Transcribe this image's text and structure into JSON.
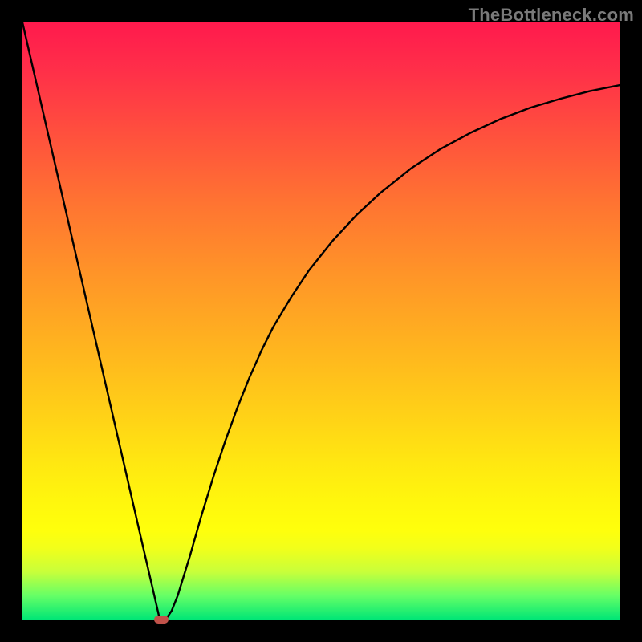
{
  "watermark": "TheBottleneck.com",
  "colors": {
    "frame": "#000000",
    "curve": "#000000",
    "marker": "#c1524a"
  },
  "chart_data": {
    "type": "line",
    "title": "",
    "xlabel": "",
    "ylabel": "",
    "xlim": [
      0,
      100
    ],
    "ylim": [
      0,
      100
    ],
    "x": [
      0,
      2,
      4,
      6,
      8,
      10,
      12,
      14,
      16,
      18,
      20,
      22,
      23,
      24,
      25,
      26,
      28,
      30,
      32,
      34,
      36,
      38,
      40,
      42,
      45,
      48,
      52,
      56,
      60,
      65,
      70,
      75,
      80,
      85,
      90,
      95,
      100
    ],
    "values": [
      100,
      91.3,
      82.6,
      73.9,
      65.2,
      56.5,
      47.8,
      39.1,
      30.4,
      21.7,
      13.0,
      4.35,
      0.0,
      0.0,
      1.5,
      4.0,
      10.5,
      17.5,
      24.0,
      30.0,
      35.5,
      40.5,
      45.0,
      49.0,
      54.0,
      58.5,
      63.5,
      67.8,
      71.5,
      75.5,
      78.8,
      81.5,
      83.8,
      85.7,
      87.2,
      88.5,
      89.5
    ],
    "marker": {
      "x": 23.3,
      "y": 0.0
    }
  }
}
